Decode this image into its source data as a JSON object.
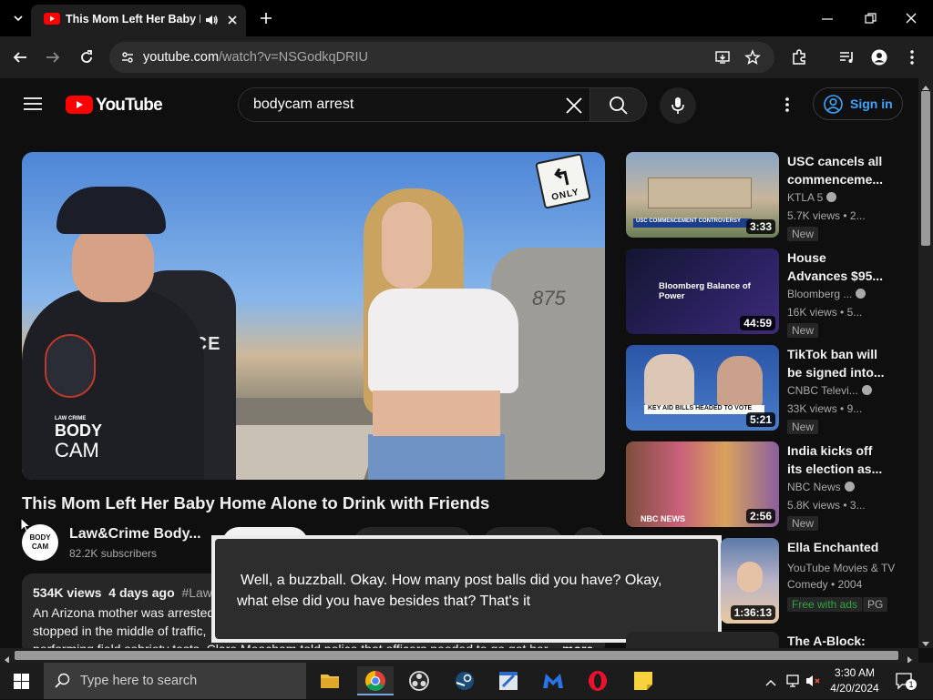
{
  "browser": {
    "tab_title": "This Mom Left Her Baby Home Alone",
    "url_domain": "youtube.com",
    "url_path": "/watch?v=NSGodkqDRIU"
  },
  "youtube": {
    "logo_text": "YouTube",
    "search_query": "bodycam arrest",
    "signin_label": "Sign in"
  },
  "video": {
    "overlay_brand_small": "LAW CRIME",
    "overlay_brand_line1": "BODY",
    "overlay_brand_line2": "CAM",
    "badge_text": "POLICE",
    "sign_text": "ONLY",
    "plate_text": "875",
    "title": "This Mom Left Her Baby Home Alone to Drink with Friends",
    "channel_name": "Law&Crime Body...",
    "channel_avatar_line1": "BODY",
    "channel_avatar_line2": "CAM",
    "subscribers": "82.2K subscribers",
    "views": "534K views",
    "age": "4 days ago",
    "hashtag": "#Lawa",
    "description_line1": "An Arizona mother was arrested",
    "description_line2": "stopped in the middle of traffic,",
    "description_line3": "performing field sobriety tests. Clare Meacham told police that officers needed to go get her",
    "more_label": "...more"
  },
  "caption": {
    "line1": "Well, a buzzball. Okay. How many post balls did you have? Okay,",
    "line2": "what else did you have besides that? That's it"
  },
  "recommendations": [
    {
      "title": "USC cancels all commenceme...",
      "channel": "KTLA 5",
      "verified": true,
      "views": "5.7K views",
      "age": "2...",
      "duration": "3:33",
      "badge": "New",
      "thumb_text": "USC COMMENCEMENT CONTROVERSY",
      "thumb_color_a": "#b9a48a",
      "thumb_color_b": "#6f8fb0"
    },
    {
      "title": "House Advances $95...",
      "channel": "Bloomberg ...",
      "verified": true,
      "views": "16K views",
      "age": "5...",
      "duration": "44:59",
      "badge": "New",
      "thumb_text": "Bloomberg Balance of Power",
      "thumb_color_a": "#1a1c3a",
      "thumb_color_b": "#3b2d6b"
    },
    {
      "title": "TikTok ban will be signed into...",
      "channel": "CNBC Televi...",
      "verified": true,
      "views": "33K views",
      "age": "9...",
      "duration": "5:21",
      "badge": "New",
      "thumb_text": "KEY AID BILLS HEADED TO VOTE",
      "thumb_color_a": "#1b3a7a",
      "thumb_color_b": "#3c6fb8"
    },
    {
      "title": "India kicks off its election as...",
      "channel": "NBC News",
      "verified": true,
      "views": "5.8K views",
      "age": "3...",
      "duration": "2:56",
      "badge": "New",
      "thumb_text": "NBC NEWS",
      "thumb_color_a": "#a25d4a",
      "thumb_color_b": "#d5a050"
    },
    {
      "title": "Ella Enchanted",
      "channel": "YouTube Movies & TV",
      "channel2": "Comedy • 2004",
      "duration": "1:36:13",
      "badge_green": "Free with ads",
      "rating": "PG",
      "thumb_color_a": "#5b7aa8",
      "thumb_color_b": "#e8c9a2"
    },
    {
      "title": "The A-Block:",
      "thumb_color_a": "#222",
      "thumb_color_b": "#333"
    }
  ],
  "taskbar": {
    "search_placeholder": "Type here to search",
    "time": "3:30 AM",
    "date": "4/20/2024",
    "notification_count": "1"
  }
}
